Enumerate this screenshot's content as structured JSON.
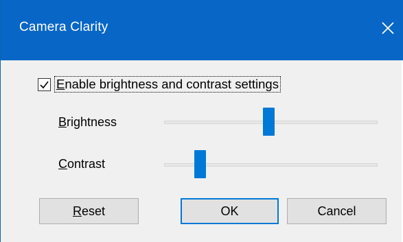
{
  "window": {
    "title": "Camera Clarity",
    "close_icon": "close-icon"
  },
  "settings": {
    "enable_checkbox": {
      "checked": true,
      "label_first": "E",
      "label_rest": "nable brightness and contrast settings"
    },
    "brightness": {
      "label_first": "B",
      "label_rest": "rightness",
      "level": 0.49
    },
    "contrast": {
      "label_first": "C",
      "label_rest": "ontrast",
      "level": 0.15
    }
  },
  "buttons": {
    "reset_first": "R",
    "reset_rest": "eset",
    "ok": "OK",
    "cancel": "Cancel"
  },
  "colors": {
    "titlebar": "#0866c6",
    "accent": "#0078d7"
  }
}
